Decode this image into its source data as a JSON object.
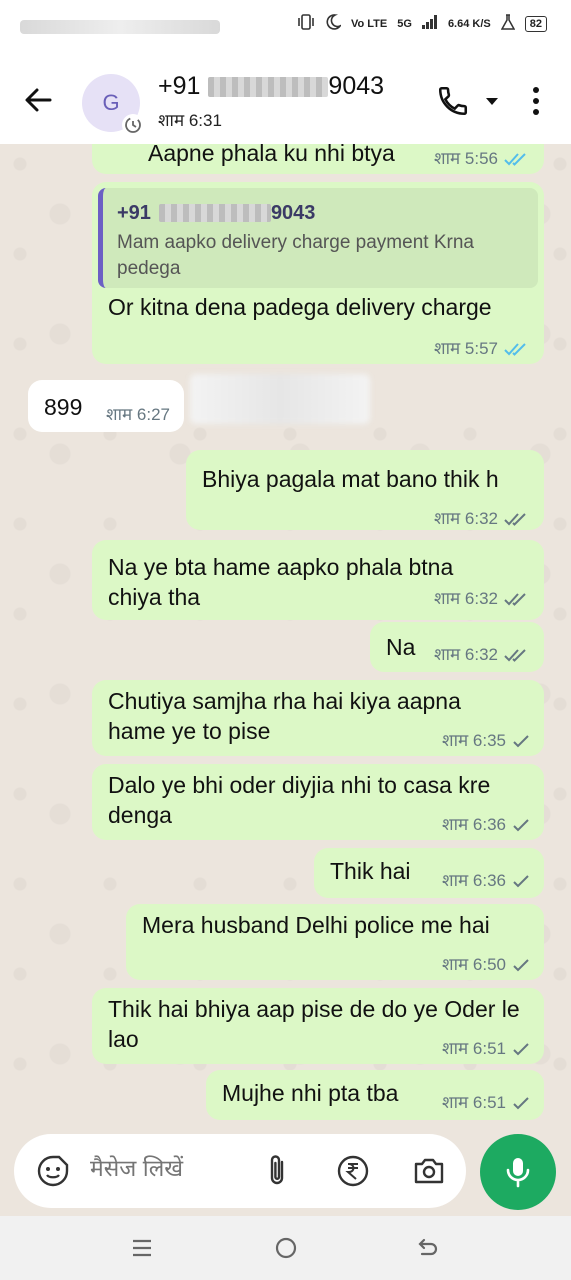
{
  "status_bar": {
    "network": "Vo LTE",
    "signal": "5G",
    "speed": "6.64 K/S",
    "battery": "82"
  },
  "header": {
    "avatar_letter": "G",
    "contact_prefix": "+91",
    "contact_suffix": "9043",
    "last_seen": "शाम 6:31"
  },
  "messages": [
    {
      "direction": "out",
      "text": "Aapne phala ku nhi btya",
      "time": "शाम 5:56",
      "status": "read"
    },
    {
      "direction": "out",
      "quote": {
        "sender_prefix": "+91",
        "sender_suffix": "9043",
        "text": "Mam aapko delivery charge payment Krna pedega"
      },
      "text": "Or kitna dena padega delivery charge",
      "time": "शाम 5:57",
      "status": "read"
    },
    {
      "direction": "in",
      "text": "899",
      "time": "शाम 6:27"
    },
    {
      "direction": "out",
      "text": "Bhiya pagala mat bano thik h",
      "time": "शाम 6:32",
      "status": "delivered"
    },
    {
      "direction": "out",
      "text": "Na ye bta hame aapko  phala btna chiya tha",
      "time": "शाम 6:32",
      "status": "delivered"
    },
    {
      "direction": "out",
      "text": "Na",
      "time": "शाम 6:32",
      "status": "delivered"
    },
    {
      "direction": "out",
      "text": "Chutiya samjha rha hai kiya aapna hame ye to pise",
      "time": "शाम 6:35",
      "status": "sent"
    },
    {
      "direction": "out",
      "text": "Dalo ye bhi oder diyjia nhi to casa kre denga",
      "time": "शाम 6:36",
      "status": "sent"
    },
    {
      "direction": "out",
      "text": "Thik hai",
      "time": "शाम 6:36",
      "status": "sent"
    },
    {
      "direction": "out",
      "text": "Mera husband Delhi police me hai",
      "time": "शाम 6:50",
      "status": "sent"
    },
    {
      "direction": "out",
      "text": "Thik hai bhiya aap pise de do ye Oder le lao",
      "time": "शाम 6:51",
      "status": "sent"
    },
    {
      "direction": "out",
      "text": "Mujhe nhi pta tba",
      "time": "शाम 6:51",
      "status": "sent"
    }
  ],
  "composer": {
    "placeholder": "मैसेज लिखें",
    "emoji_icon": "sticker-emoji-icon",
    "attach_icon": "paperclip-icon",
    "payment_icon": "rupee-icon",
    "camera_icon": "camera-icon",
    "mic_icon": "microphone-icon"
  },
  "colors": {
    "outgoing_bubble": "#dcf8c6",
    "incoming_bubble": "#ffffff",
    "read_tick": "#53bdeb",
    "accent_green": "#1daa61",
    "quote_bar": "#6b5fc4"
  }
}
